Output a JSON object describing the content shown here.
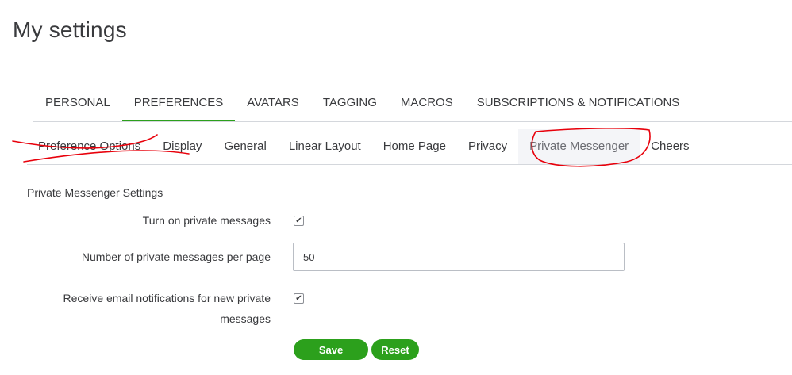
{
  "page": {
    "title": "My settings"
  },
  "main_tabs": [
    {
      "label": "PERSONAL"
    },
    {
      "label": "PREFERENCES",
      "active": true
    },
    {
      "label": "AVATARS"
    },
    {
      "label": "TAGGING"
    },
    {
      "label": "MACROS"
    },
    {
      "label": "SUBSCRIPTIONS & NOTIFICATIONS"
    }
  ],
  "sub_tabs": [
    {
      "label": "Preference Options"
    },
    {
      "label": "Display"
    },
    {
      "label": "General"
    },
    {
      "label": "Linear Layout"
    },
    {
      "label": "Home Page"
    },
    {
      "label": "Privacy"
    },
    {
      "label": "Private Messenger",
      "active": true
    },
    {
      "label": "Cheers"
    }
  ],
  "form": {
    "section_title": "Private Messenger Settings",
    "turn_on_label": "Turn on private messages",
    "turn_on_checked": true,
    "per_page_label": "Number of private messages per page",
    "per_page_value": "50",
    "email_label_line1": "Receive email notifications for new private",
    "email_label_line2": "messages",
    "email_checked": true,
    "check_glyph": "✔"
  },
  "buttons": {
    "save": "Save",
    "reset": "Reset"
  },
  "colors": {
    "accent": "#2ca01c",
    "annotation": "#e8000b",
    "text": "#393a3d"
  }
}
